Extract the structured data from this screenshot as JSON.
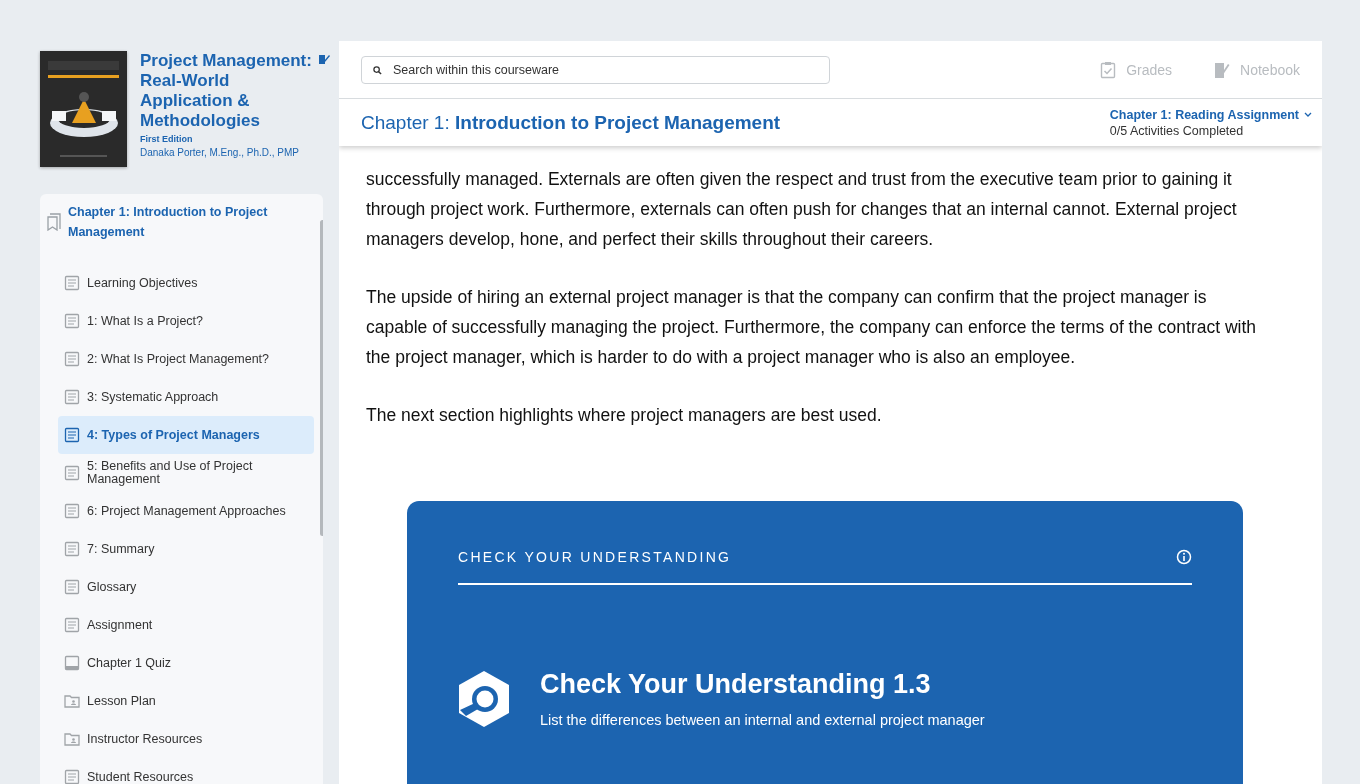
{
  "book": {
    "title": "Project Management: Real-World Application & Methodologies",
    "edition": "First Edition",
    "author": "Danaka Porter, M.Eng., Ph.D., PMP"
  },
  "toc": {
    "chapter": "Chapter 1: Introduction to Project Management",
    "items": [
      {
        "label": "Learning Objectives",
        "kind": "page",
        "selected": false
      },
      {
        "label": "1: What Is a Project?",
        "kind": "page",
        "selected": false
      },
      {
        "label": "2: What Is Project Management?",
        "kind": "page",
        "selected": false
      },
      {
        "label": "3: Systematic Approach",
        "kind": "page",
        "selected": false
      },
      {
        "label": "4: Types of Project Managers",
        "kind": "page",
        "selected": true
      },
      {
        "label": "5: Benefits and Use of Project Management",
        "kind": "page",
        "selected": false
      },
      {
        "label": "6: Project Management Approaches",
        "kind": "page",
        "selected": false
      },
      {
        "label": "7: Summary",
        "kind": "page",
        "selected": false
      },
      {
        "label": "Glossary",
        "kind": "page",
        "selected": false
      },
      {
        "label": "Assignment",
        "kind": "page",
        "selected": false
      },
      {
        "label": "Chapter 1 Quiz",
        "kind": "quiz",
        "selected": false
      },
      {
        "label": "Lesson Plan",
        "kind": "folder",
        "selected": false
      },
      {
        "label": "Instructor Resources",
        "kind": "folder",
        "selected": false
      },
      {
        "label": "Student Resources",
        "kind": "page",
        "selected": false
      }
    ]
  },
  "search": {
    "placeholder": "Search within this courseware"
  },
  "toolbar": [
    {
      "label": "Grades",
      "kind": "grades"
    },
    {
      "label": "Notebook",
      "kind": "notebook"
    }
  ],
  "chapter_header": {
    "prefix": "Chapter 1:",
    "title": "Introduction to Project Management",
    "assignment": "Chapter 1: Reading Assignment",
    "progress": "0/5 Activities Completed"
  },
  "paragraphs": [
    "successfully managed. Externals are often given the respect and trust from the executive team prior to gaining it through project work. Furthermore, externals can often push for changes that an internal cannot. External project managers develop, hone, and perfect their skills throughout their careers.",
    "The upside of hiring an external project manager is that the company can confirm that the project manager is capable of successfully managing the project. Furthermore, the company can enforce the terms of the contract with the project manager, which is harder to do with a project manager who is also an employee.",
    "The next section highlights where project managers are best used."
  ],
  "check_card": {
    "heading": "CHECK YOUR UNDERSTANDING",
    "title": "Check Your Understanding 1.3",
    "description": "List the differences between an internal and external project manager"
  }
}
